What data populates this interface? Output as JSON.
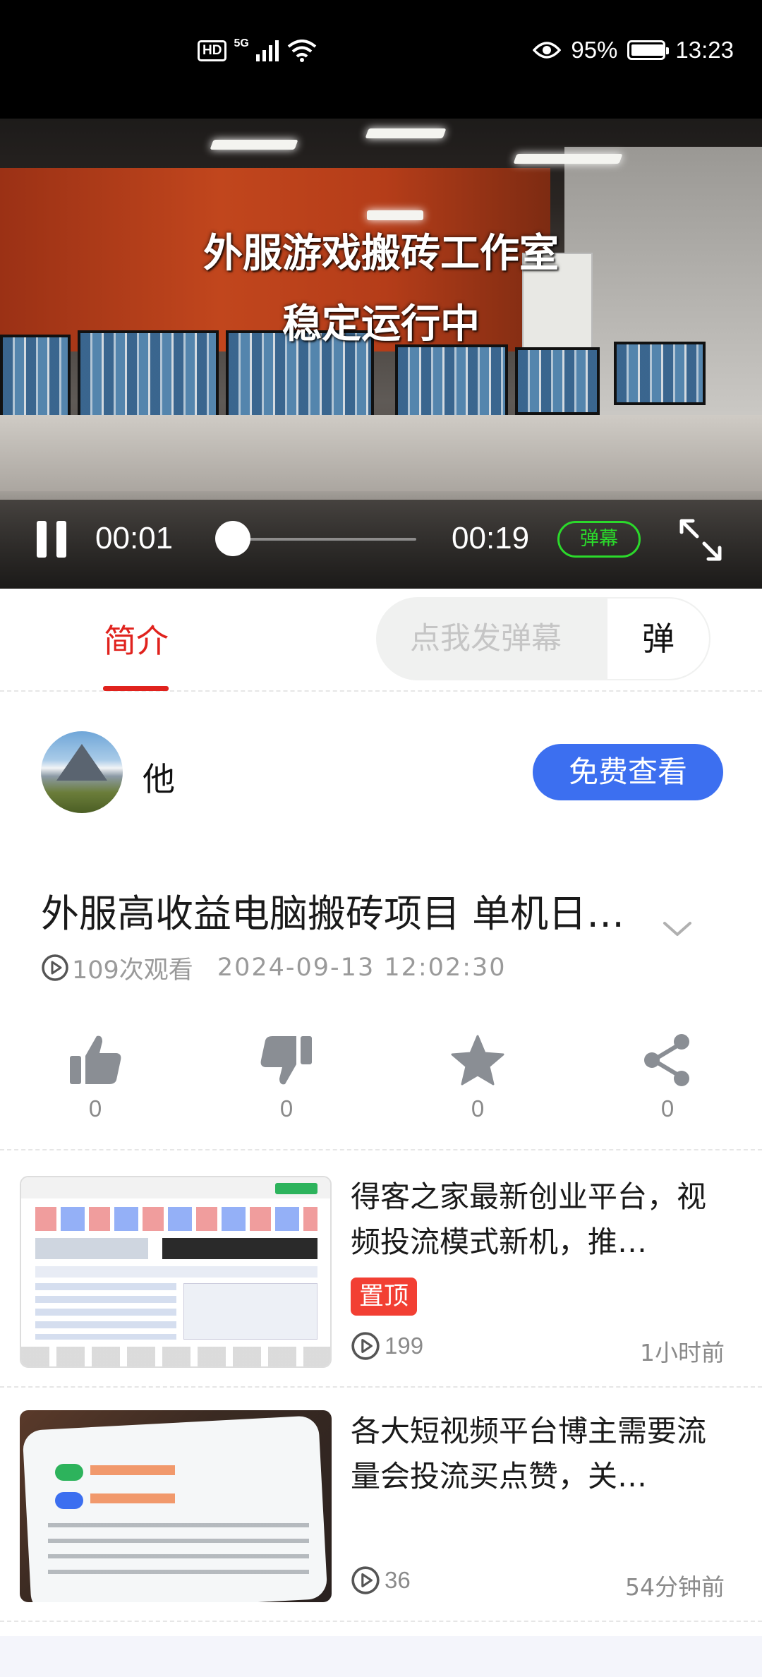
{
  "status_bar": {
    "hd": "HD",
    "network": "5G",
    "battery_pct": "95%",
    "battery_level": 0.95,
    "time": "13:23",
    "icons": [
      "hd-icon",
      "signal-icon",
      "wifi-icon",
      "eye-icon",
      "battery-icon"
    ]
  },
  "video": {
    "caption_line1": "外服游戏搬砖工作室",
    "caption_line2": "稳定运行中",
    "current_time": "00:01",
    "total_time": "00:19",
    "progress": 0.05,
    "danmu_toggle": "弹幕"
  },
  "tabs": {
    "intro": "简介",
    "danmu_placeholder": "点我发弹幕",
    "danmu_send": "弹"
  },
  "author": {
    "name": "他",
    "free_view_button": "免费查看"
  },
  "video_info": {
    "title": "外服高收益电脑搬砖项目 单机日…",
    "views": "109次观看",
    "date": "2024-09-13 12:02:30"
  },
  "actions": [
    {
      "name": "like",
      "icon": "thumbs-up-icon",
      "count": "0"
    },
    {
      "name": "dislike",
      "icon": "thumbs-down-icon",
      "count": "0"
    },
    {
      "name": "favorite",
      "icon": "star-icon",
      "count": "0"
    },
    {
      "name": "share",
      "icon": "share-icon",
      "count": "0"
    }
  ],
  "related": [
    {
      "title": "得客之家最新创业平台，视频投流模式新机，推…",
      "tag": "置顶",
      "views": "199",
      "time": "1小时前"
    },
    {
      "title": "各大短视频平台博主需要流量会投流买点赞，关…",
      "tag": "",
      "views": "36",
      "time": "54分钟前"
    }
  ],
  "colors": {
    "accent_red": "#e0221d",
    "button_blue": "#3c6ff0",
    "danmu_green": "#2bd92b",
    "pin_red": "#f23f33"
  }
}
